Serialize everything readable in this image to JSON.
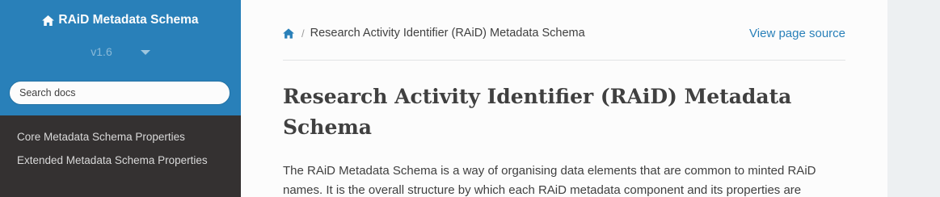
{
  "sidebar": {
    "project_title": "RAiD Metadata Schema",
    "version": "v1.6",
    "search_placeholder": "Search docs",
    "nav_items": [
      {
        "label": "Core Metadata Schema Properties"
      },
      {
        "label": "Extended Metadata Schema Properties"
      }
    ]
  },
  "breadcrumb": {
    "home_icon": "home-icon",
    "current": "Research Activity Identifier (RAiD) Metadata Schema",
    "view_source": "View page source"
  },
  "main": {
    "title": "Research Activity Identifier (RAiD) Metadata Schema",
    "paragraph": "The RAiD Metadata Schema is a way of organising data elements that are common to minted RAiD names. It is the overall structure by which each RAiD metadata component and its properties are"
  },
  "colors": {
    "sidebar_header": "#2980b9",
    "sidebar_bg": "#343131",
    "link": "#2980b9",
    "text": "#404040"
  }
}
